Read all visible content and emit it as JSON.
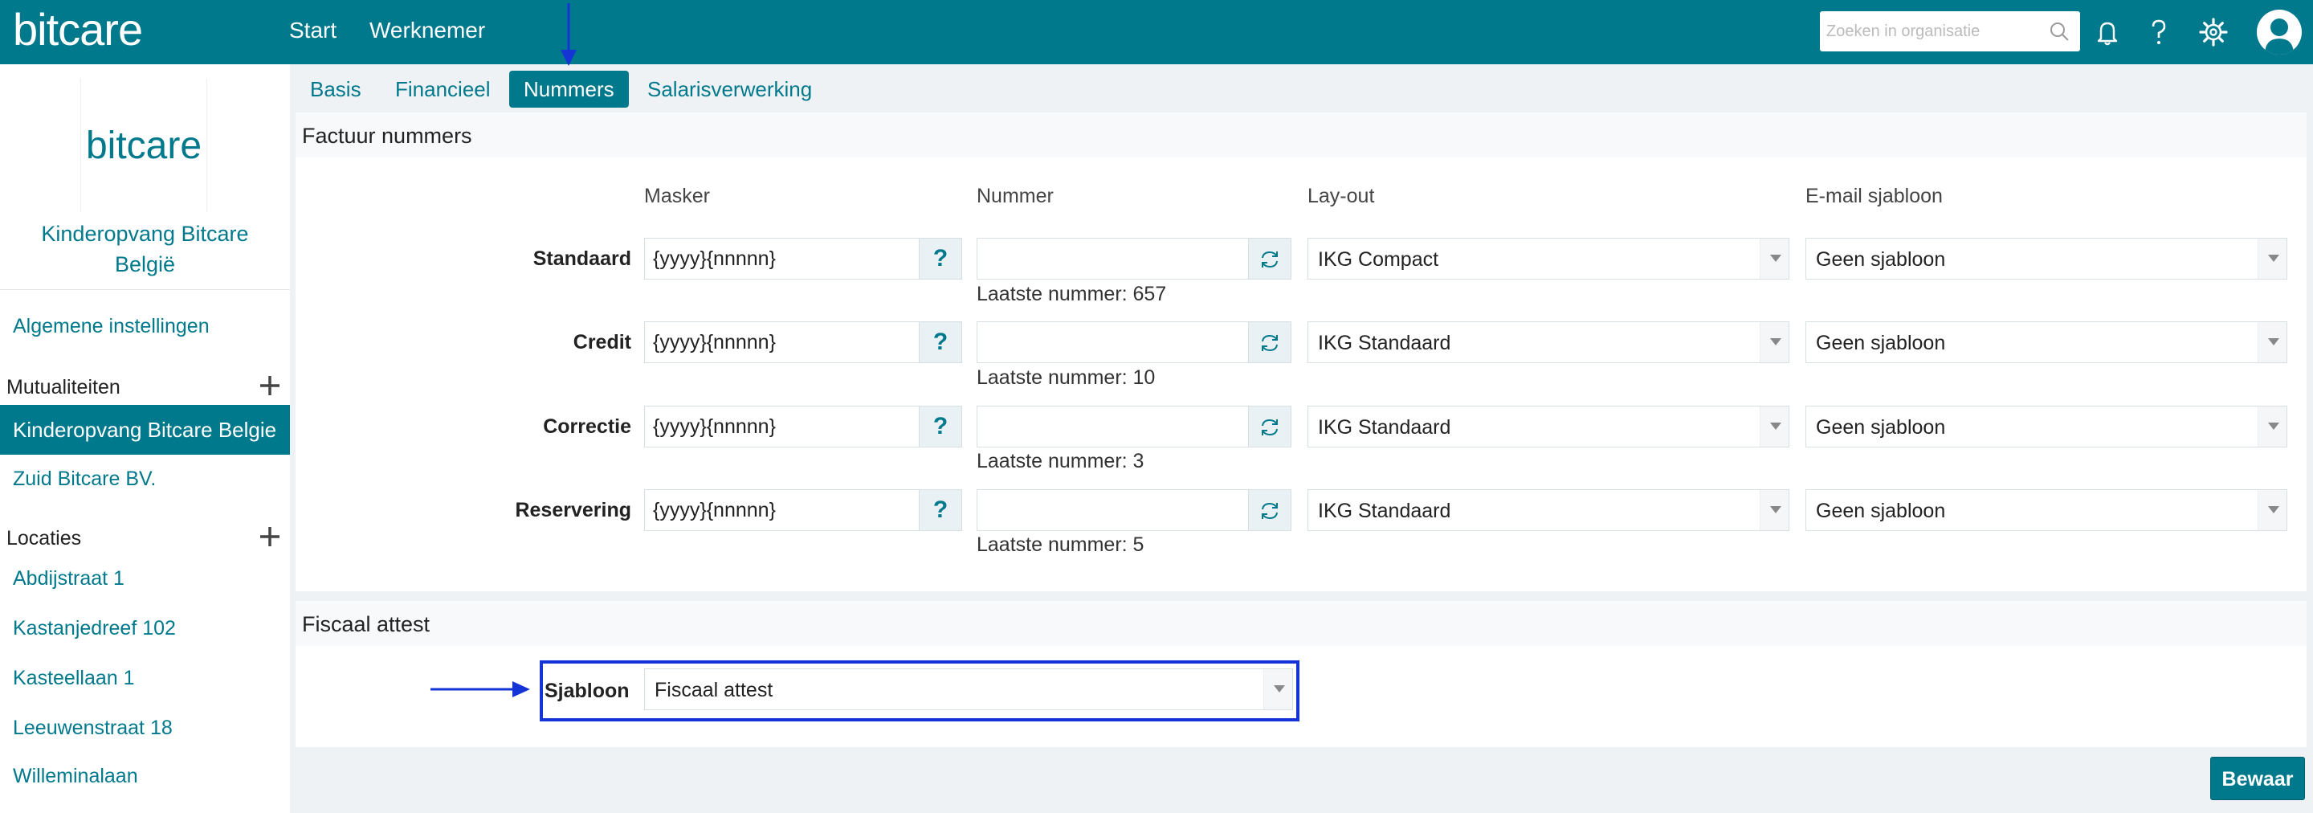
{
  "app": {
    "logo": "bitcare"
  },
  "topnav": {
    "start": "Start",
    "werknemer": "Werknemer"
  },
  "search": {
    "placeholder": "Zoeken in organisatie",
    "value": ""
  },
  "sidebar": {
    "org_logo": "bitcare",
    "org_name_line1": "Kinderopvang Bitcare",
    "org_name_line2": "België",
    "general_settings": "Algemene instellingen",
    "mutualities_header": "Mutualiteiten",
    "mutualities": [
      "Kinderopvang Bitcare Belgie",
      "Zuid Bitcare BV."
    ],
    "locations_header": "Locaties",
    "locations": [
      "Abdijstraat 1",
      "Kastanjedreef 102",
      "Kasteellaan 1",
      "Leeuwenstraat 18",
      "Willeminalaan"
    ]
  },
  "tabs": [
    "Basis",
    "Financieel",
    "Nummers",
    "Salarisverwerking"
  ],
  "active_tab": "Nummers",
  "invoice_numbers": {
    "title": "Factuur nummers",
    "columns": {
      "mask": "Masker",
      "number": "Nummer",
      "layout": "Lay-out",
      "email_template": "E-mail sjabloon"
    },
    "rows": [
      {
        "label": "Standaard",
        "mask": "{yyyy}{nnnnn}",
        "number": "",
        "last_number": "Laatste nummer: 657",
        "layout": "IKG Compact",
        "email": "Geen sjabloon"
      },
      {
        "label": "Credit",
        "mask": "{yyyy}{nnnnn}",
        "number": "",
        "last_number": "Laatste nummer: 10",
        "layout": "IKG Standaard",
        "email": "Geen sjabloon"
      },
      {
        "label": "Correctie",
        "mask": "{yyyy}{nnnnn}",
        "number": "",
        "last_number": "Laatste nummer: 3",
        "layout": "IKG Standaard",
        "email": "Geen sjabloon"
      },
      {
        "label": "Reservering",
        "mask": "{yyyy}{nnnnn}",
        "number": "",
        "last_number": "Laatste nummer: 5",
        "layout": "IKG Standaard",
        "email": "Geen sjabloon"
      }
    ],
    "help_symbol": "?"
  },
  "fiscal_certificate": {
    "title": "Fiscaal attest",
    "template_label": "Sjabloon",
    "template_value": "Fiscaal attest"
  },
  "save_label": "Bewaar",
  "colors": {
    "brand": "#00798c",
    "annotation": "#1434d6"
  }
}
